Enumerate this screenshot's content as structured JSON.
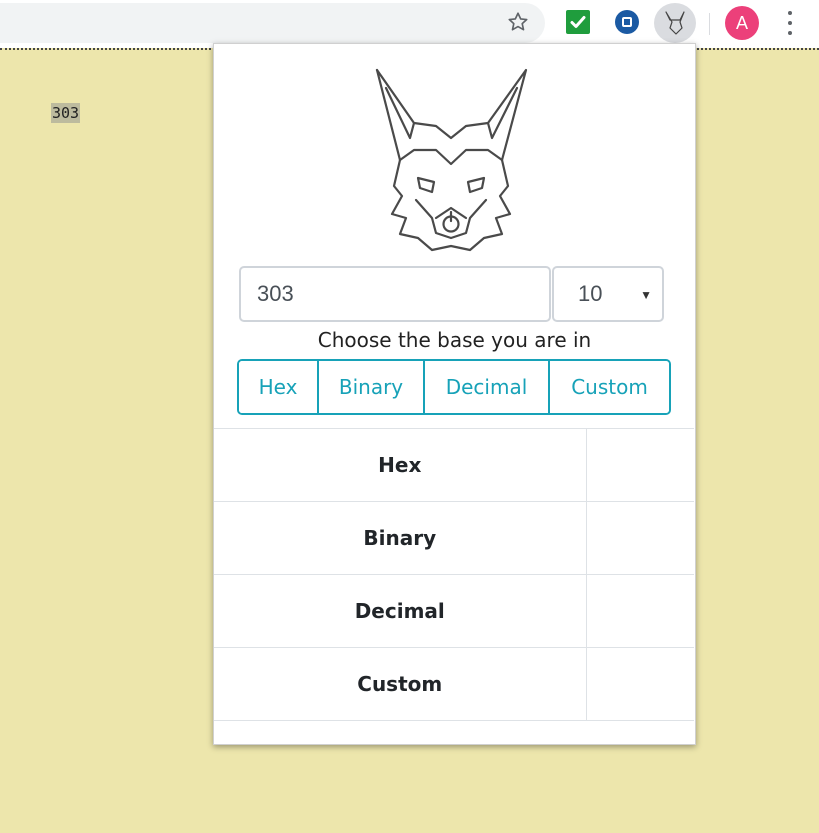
{
  "browser": {
    "star_icon": "star-icon",
    "extensions": [
      "checkmark-extension-icon",
      "blue-square-extension-icon",
      "fox-extension-icon"
    ],
    "profile_initial": "A",
    "menu_icon": "kebab-menu-icon"
  },
  "page": {
    "selected_text": "303"
  },
  "popup": {
    "logo_icon": "fox-power-logo-icon",
    "number_value": "303",
    "base_selected": "10",
    "caption": "Choose the base you are in",
    "base_buttons": [
      "Hex",
      "Binary",
      "Decimal",
      "Custom"
    ],
    "results": [
      {
        "label": "Hex",
        "value": ""
      },
      {
        "label": "Binary",
        "value": ""
      },
      {
        "label": "Decimal",
        "value": ""
      },
      {
        "label": "Custom",
        "value": ""
      }
    ]
  },
  "colors": {
    "page_background": "#ede6ac",
    "accent": "#17a2b8",
    "avatar": "#ec407a"
  }
}
